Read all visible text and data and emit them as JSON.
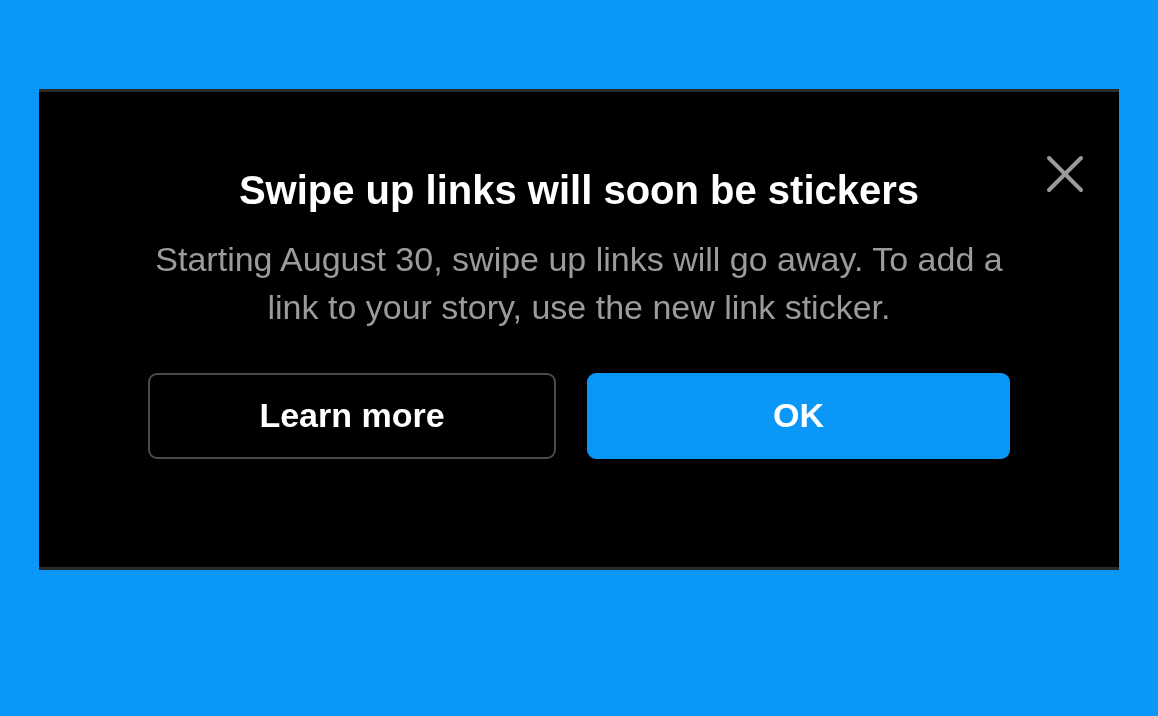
{
  "dialog": {
    "title": "Swipe up links will soon be stickers",
    "message": "Starting August 30, swipe up links will go away. To add a link to your story, use the new link sticker.",
    "buttons": [
      {
        "label": "Learn more",
        "kind": "secondary"
      },
      {
        "label": "OK",
        "kind": "primary"
      }
    ]
  }
}
